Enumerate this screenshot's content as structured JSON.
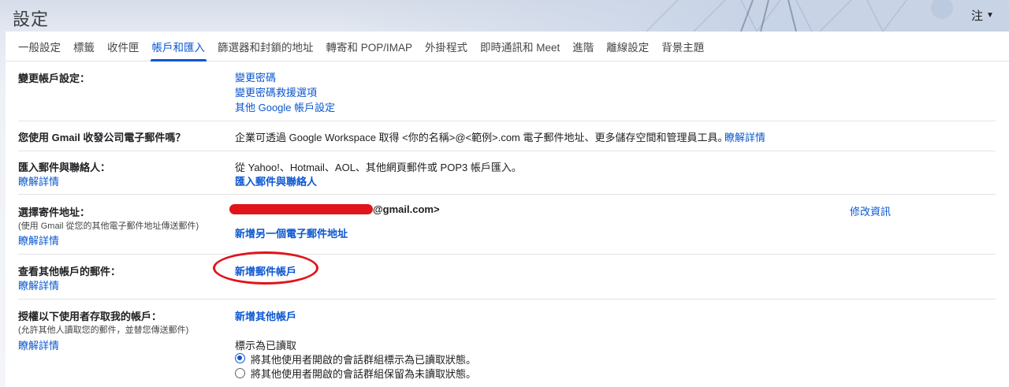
{
  "header": {
    "title": "設定",
    "account_label": "注",
    "account_caret_icon": "caret-down-icon"
  },
  "tabs": [
    {
      "label": "一般設定"
    },
    {
      "label": "標籤"
    },
    {
      "label": "收件匣"
    },
    {
      "label": "帳戶和匯入",
      "active": true
    },
    {
      "label": "篩選器和封鎖的地址"
    },
    {
      "label": "轉寄和 POP/IMAP"
    },
    {
      "label": "外掛程式"
    },
    {
      "label": "即時通訊和 Meet"
    },
    {
      "label": "進階"
    },
    {
      "label": "離線設定"
    },
    {
      "label": "背景主題"
    }
  ],
  "sections": {
    "change_account": {
      "label": "變更帳戶設定：",
      "links": [
        "變更密碼",
        "變更密碼救援選項",
        "其他 Google 帳戶設定"
      ]
    },
    "workspace": {
      "label": "您使用 Gmail 收發公司電子郵件嗎？",
      "text": "企業可透過 Google Workspace 取得 <你的名稱>@<範例>.com 電子郵件地址、更多儲存空間和管理員工具。",
      "learn_more": "瞭解詳情"
    },
    "import": {
      "label": "匯入郵件與聯絡人：",
      "learn_more": "瞭解詳情",
      "text": "從 Yahoo!、Hotmail、AOL、其他網頁郵件或 POP3 帳戶匯入。",
      "action": "匯入郵件與聯絡人"
    },
    "send_as": {
      "label": "選擇寄件地址：",
      "sub": "(使用 Gmail 從您的其他電子郵件地址傳送郵件)",
      "learn_more": "瞭解詳情",
      "address_suffix": "@gmail.com>",
      "edit": "修改資訊",
      "add": "新增另一個電子郵件地址"
    },
    "check_mail": {
      "label": "查看其他帳戶的郵件：",
      "learn_more": "瞭解詳情",
      "add": "新增郵件帳戶"
    },
    "grant_access": {
      "label": "授權以下使用者存取我的帳戶：",
      "sub": "(允許其他人讀取您的郵件，並替您傳送郵件)",
      "learn_more": "瞭解詳情",
      "add": "新增其他帳戶",
      "mark_read_title": "標示為已讀取",
      "options": [
        {
          "label": "將其他使用者開啟的會話群組標示為已讀取狀態。",
          "checked": true
        },
        {
          "label": "將其他使用者開啟的會話群組保留為未讀取狀態。",
          "checked": false
        }
      ]
    }
  },
  "colors": {
    "link": "#0b57d0",
    "annotation_red": "#e0141a"
  }
}
